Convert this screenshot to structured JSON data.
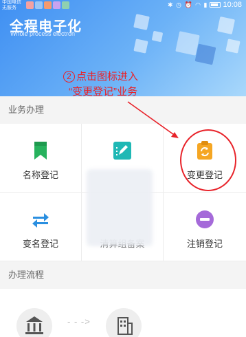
{
  "status_bar": {
    "carrier_line1": "中国电信",
    "carrier_line2": "无服务",
    "time": "10:08"
  },
  "banner": {
    "title": "全程电子化",
    "subtitle": "Whole process electron"
  },
  "annotation": {
    "step_number": "2",
    "line1": "点击图标进入",
    "line2": "“变更登记”业务",
    "color": "#e8232a"
  },
  "sections": {
    "business": "业务办理",
    "process": "办理流程"
  },
  "tiles": [
    {
      "label": "名称登记",
      "icon": "bookmark-icon",
      "color": "#27b25d"
    },
    {
      "label": "",
      "icon": "edit-note-icon",
      "color": "#1fb8b5"
    },
    {
      "label": "变更登记",
      "icon": "change-clipboard-icon",
      "color": "#f5a623"
    },
    {
      "label": "变名登记",
      "icon": "swap-arrows-icon",
      "color": "#2a8fe0"
    },
    {
      "label": "清算组备案",
      "icon": "",
      "color": ""
    },
    {
      "label": "注销登记",
      "icon": "minus-circle-icon",
      "color": "#a56ad9"
    }
  ],
  "process_steps": [
    {
      "icon": "bank-building-icon"
    },
    {
      "icon": "office-building-icon"
    }
  ]
}
